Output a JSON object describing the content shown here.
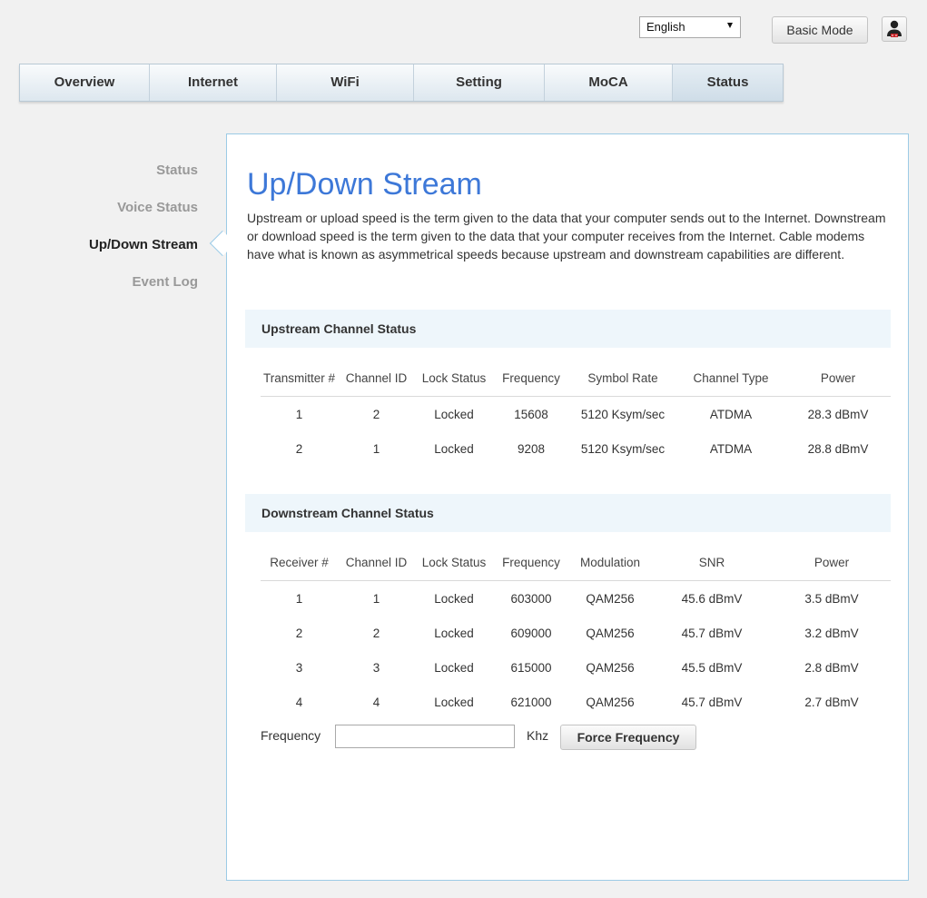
{
  "header": {
    "language": "English",
    "basic_mode_label": "Basic Mode",
    "user_icon": "user-icon"
  },
  "nav": {
    "tabs": [
      {
        "label": "Overview"
      },
      {
        "label": "Internet"
      },
      {
        "label": "WiFi"
      },
      {
        "label": "Setting"
      },
      {
        "label": "MoCA"
      },
      {
        "label": "Status"
      }
    ],
    "active": "Status"
  },
  "sidebar": {
    "items": [
      {
        "label": "Status"
      },
      {
        "label": "Voice Status"
      },
      {
        "label": "Up/Down Stream"
      },
      {
        "label": "Event Log"
      }
    ],
    "active": "Up/Down Stream"
  },
  "main": {
    "title": "Up/Down Stream",
    "description": "Upstream or upload speed is the term given to the data that your computer sends out to the Internet. Downstream or download speed is the term given to the data that your computer receives from the Internet. Cable modems have what is known as asymmetrical speeds because upstream and downstream capabilities are different.",
    "upstream": {
      "heading": "Upstream Channel Status",
      "columns": [
        "Transmitter #",
        "Channel ID",
        "Lock Status",
        "Frequency",
        "Symbol Rate",
        "Channel Type",
        "Power"
      ],
      "rows": [
        [
          "1",
          "2",
          "Locked",
          "15608",
          "5120 Ksym/sec",
          "ATDMA",
          "28.3 dBmV"
        ],
        [
          "2",
          "1",
          "Locked",
          "9208",
          "5120 Ksym/sec",
          "ATDMA",
          "28.8 dBmV"
        ]
      ]
    },
    "downstream": {
      "heading": "Downstream Channel Status",
      "columns": [
        "Receiver #",
        "Channel ID",
        "Lock Status",
        "Frequency",
        "Modulation",
        "SNR",
        "Power"
      ],
      "rows": [
        [
          "1",
          "1",
          "Locked",
          "603000",
          "QAM256",
          "45.6 dBmV",
          "3.5 dBmV"
        ],
        [
          "2",
          "2",
          "Locked",
          "609000",
          "QAM256",
          "45.7 dBmV",
          "3.2 dBmV"
        ],
        [
          "3",
          "3",
          "Locked",
          "615000",
          "QAM256",
          "45.5 dBmV",
          "2.8 dBmV"
        ],
        [
          "4",
          "4",
          "Locked",
          "621000",
          "QAM256",
          "45.7 dBmV",
          "2.7 dBmV"
        ]
      ]
    },
    "force": {
      "frequency_label": "Frequency",
      "frequency_value": "",
      "unit": "Khz",
      "button_label": "Force Frequency"
    }
  },
  "colors": {
    "accent": "#3d78d8",
    "panel_border": "#9ccbe6",
    "section_bg": "#eef6fb"
  }
}
